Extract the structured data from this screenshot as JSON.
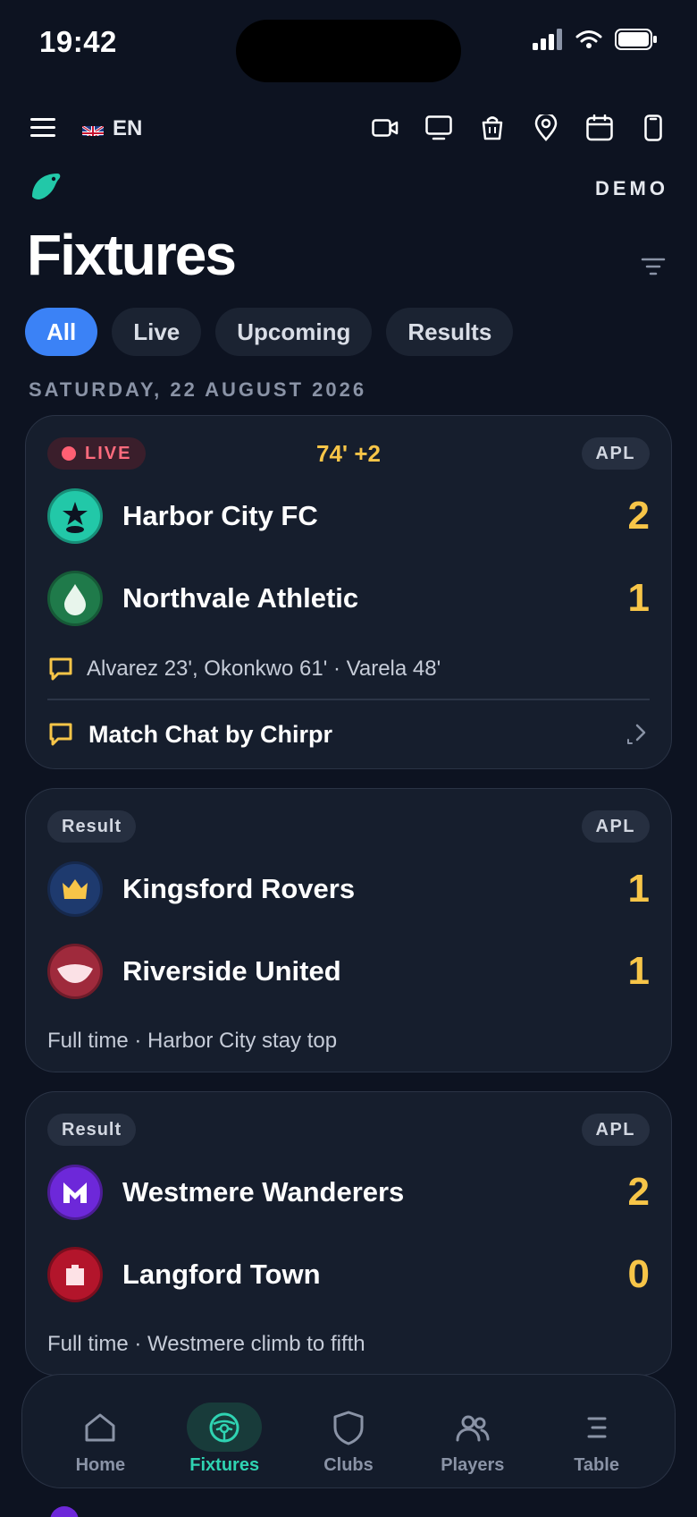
{
  "status_bar": {
    "time": "19:42"
  },
  "toolbar": {
    "language": "EN",
    "icons": [
      "video-icon",
      "tv-icon",
      "shop-bag-icon",
      "location-pin-icon",
      "calendar-icon",
      "phone-icon"
    ]
  },
  "brand": {
    "demo_label": "DEMO"
  },
  "page": {
    "title": "Fixtures"
  },
  "tabs": [
    {
      "label": "All",
      "active": true
    },
    {
      "label": "Live",
      "active": false
    },
    {
      "label": "Upcoming",
      "active": false
    },
    {
      "label": "Results",
      "active": false
    }
  ],
  "date_heading": "SATURDAY, 22 AUGUST 2026",
  "matches": [
    {
      "status": "LIVE",
      "minute": "74' +2",
      "league": "APL",
      "home": {
        "name": "Harbor City FC",
        "score": "2",
        "color": "#22c8a8"
      },
      "away": {
        "name": "Northvale Athletic",
        "score": "1",
        "color": "#1f7a4a"
      },
      "scorers": "Alvarez 23', Okonkwo 61' · Varela 48'",
      "chat": "Match Chat by Chirpr"
    },
    {
      "status": "Result",
      "league": "APL",
      "home": {
        "name": "Kingsford Rovers",
        "score": "1",
        "color": "#1e3a6e"
      },
      "away": {
        "name": "Riverside United",
        "score": "1",
        "color": "#9f2a3c"
      },
      "note": "Full time · Harbor City stay top"
    },
    {
      "status": "Result",
      "league": "APL",
      "home": {
        "name": "Westmere Wanderers",
        "score": "2",
        "color": "#6d28d9"
      },
      "away": {
        "name": "Langford Town",
        "score": "0",
        "color": "#b3152b"
      },
      "note": "Full time · Westmere climb to fifth"
    }
  ],
  "bottom_nav": [
    {
      "label": "Home",
      "icon": "home-icon",
      "active": false
    },
    {
      "label": "Fixtures",
      "icon": "stadium-icon",
      "active": true
    },
    {
      "label": "Clubs",
      "icon": "shield-icon",
      "active": false
    },
    {
      "label": "Players",
      "icon": "players-icon",
      "active": false
    },
    {
      "label": "Table",
      "icon": "table-icon",
      "active": false
    }
  ],
  "colors": {
    "accent": "#3b82f6",
    "score": "#f7c548",
    "live": "#ff5f73",
    "nav_active": "#2fd3b2",
    "background": "#0d1321"
  }
}
